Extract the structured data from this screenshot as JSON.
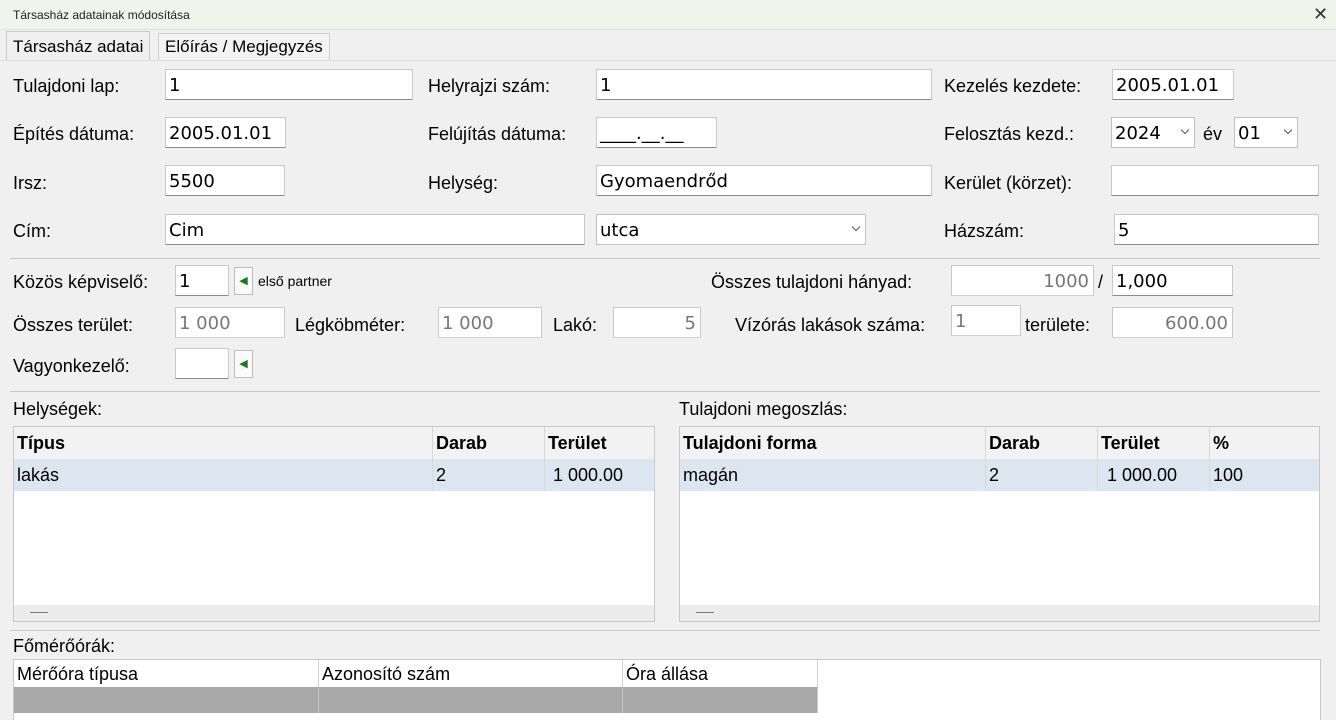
{
  "window": {
    "title": "Társasház adatainak módosítása"
  },
  "tabs": [
    {
      "label": "Társasház adatai",
      "active": true
    },
    {
      "label": "Előírás / Megjegyzés",
      "active": false
    }
  ],
  "form": {
    "tulajdoni_lap": {
      "label": "Tulajdoni lap:",
      "value": "1"
    },
    "helyrajzi_szam": {
      "label": "Helyrajzi szám:",
      "value": "1"
    },
    "kezeles_kezdete": {
      "label": "Kezelés kezdete:",
      "value": "2005.01.01"
    },
    "epites_datuma": {
      "label": "Építés dátuma:",
      "value": "2005.01.01"
    },
    "felujitas_datuma": {
      "label": "Felújítás dátuma:",
      "value": "____.__.__"
    },
    "felosztas_kezd": {
      "label": "Felosztás kezd.:",
      "year": "2024",
      "ev_label": "év",
      "month": "01"
    },
    "irsz": {
      "label": "Irsz:",
      "value": "5500"
    },
    "helyseg": {
      "label": "Helység:",
      "value": "Gyomaendrőd"
    },
    "kerulet": {
      "label": "Kerület (körzet):",
      "value": ""
    },
    "cim": {
      "label": "Cím:",
      "value": "Cim",
      "type": "utca"
    },
    "hazszam": {
      "label": "Házszám:",
      "value": "5"
    },
    "kozos_kepviselo": {
      "label": "Közös képviselő:",
      "value": "1",
      "partner": "első partner"
    },
    "osszes_tulajdoni_hanyad": {
      "label": "Összes tulajdoni hányad:",
      "value": "1000",
      "sep": "/",
      "value2": "1,000"
    },
    "osszes_terulet": {
      "label": "Összes terület:",
      "value": "1 000"
    },
    "legkobmeter": {
      "label": "Légköbméter:",
      "value": "1 000"
    },
    "lako": {
      "label": "Lakó:",
      "value": "5"
    },
    "vizoras": {
      "label": "Vízórás lakások száma:",
      "value": "1",
      "terulete_label": "területe:",
      "terulete": "600.00"
    },
    "vagyonkezelo": {
      "label": "Vagyonkezelő:",
      "value": ""
    }
  },
  "helysegek": {
    "title": "Helységek:",
    "columns": [
      "Típus",
      "Darab",
      "Terület"
    ],
    "rows": [
      [
        "lakás",
        "2",
        "1 000.00"
      ]
    ]
  },
  "tulajdoni_megoszlas": {
    "title": "Tulajdoni megoszlás:",
    "columns": [
      "Tulajdoni forma",
      "Darab",
      "Terület",
      "%"
    ],
    "rows": [
      [
        "magán",
        "2",
        "1 000.00",
        "100"
      ]
    ]
  },
  "foemeroorak": {
    "title": "Főmérőórák:",
    "columns": [
      "Mérőóra típusa",
      "Azonosító szám",
      "Óra állása"
    ]
  },
  "icons": {
    "close": "close-icon",
    "arrow": "arrow-left-icon",
    "chevron": "chevron-down-icon"
  }
}
